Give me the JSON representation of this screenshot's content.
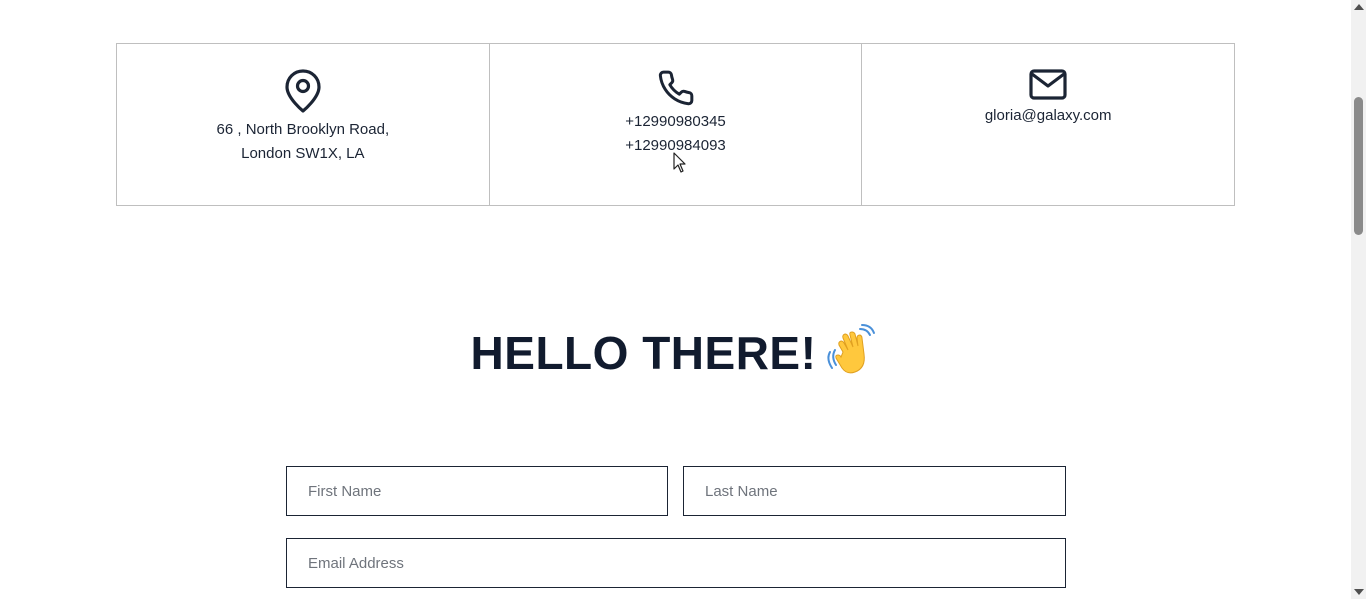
{
  "contact": {
    "address_line1": "66 , North Brooklyn Road,",
    "address_line2": "London SW1X, LA",
    "phone_1": "+12990980345",
    "phone_2": "+12990984093",
    "email": "gloria@galaxy.com",
    "icons": [
      "map-pin-icon",
      "phone-icon",
      "mail-icon"
    ]
  },
  "hello": {
    "title": "HELLO THERE!",
    "emoji_icon": "waving-hand-icon"
  },
  "form": {
    "first_name_placeholder": "First Name",
    "last_name_placeholder": "Last Name",
    "email_placeholder": "Email Address"
  },
  "colors": {
    "text": "#1b2434",
    "heading": "#111b2e",
    "border": "#bfbfbf",
    "input_border": "#1b2434",
    "wave": "#ffc83d"
  }
}
